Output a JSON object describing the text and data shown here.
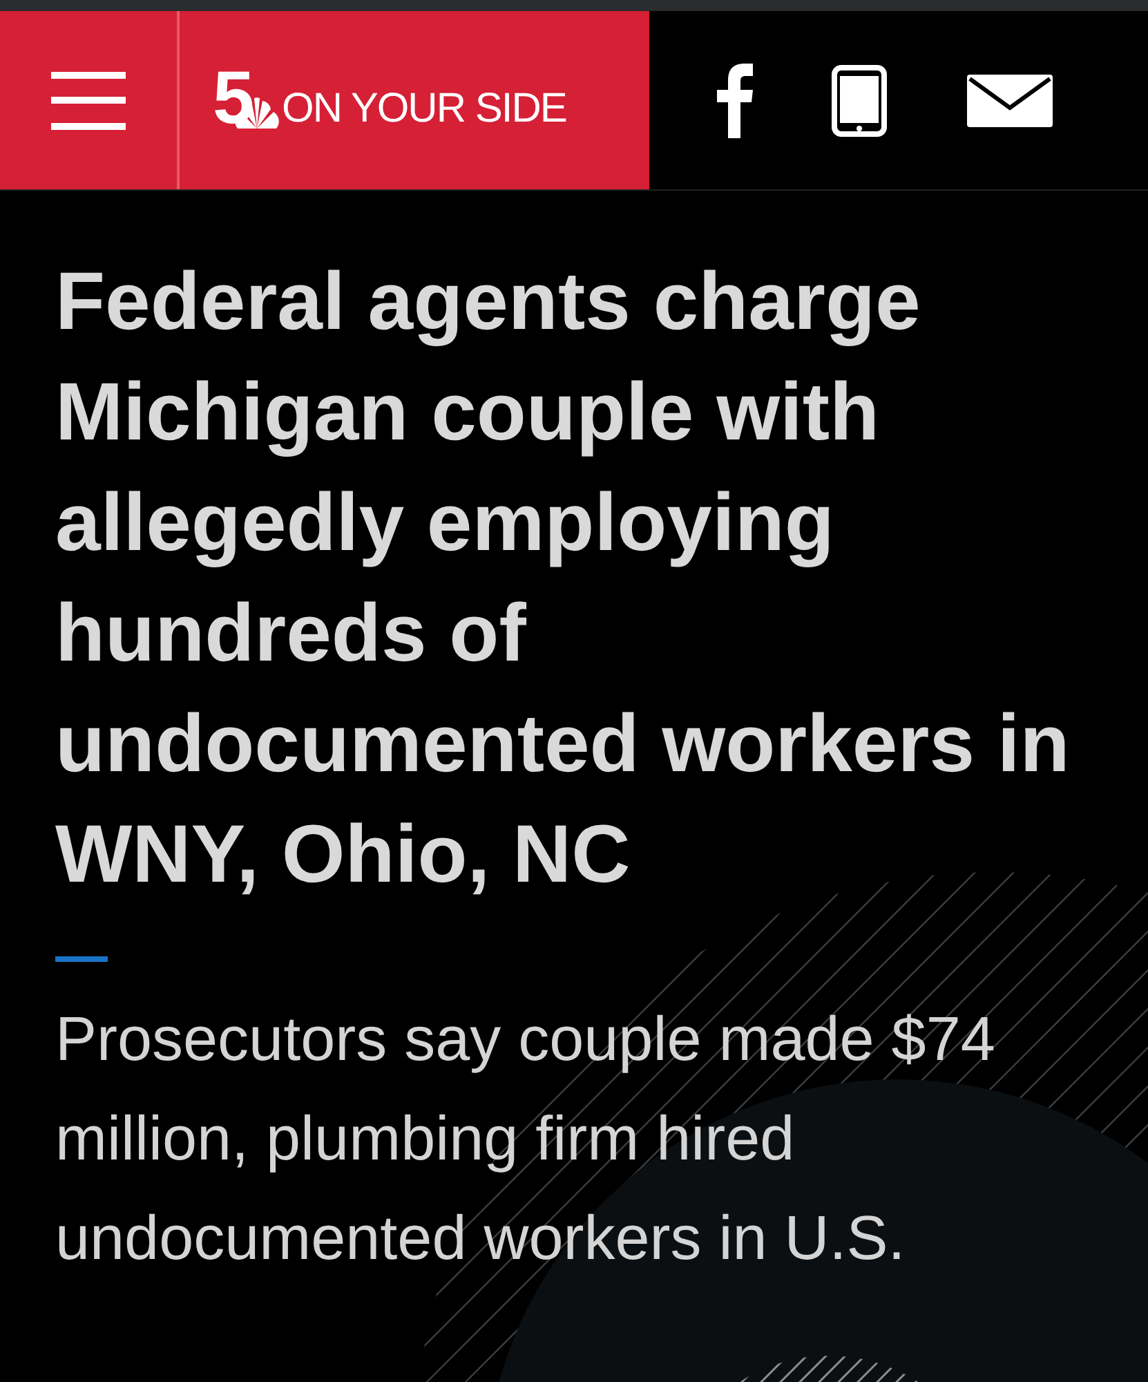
{
  "header": {
    "logo": {
      "number": "5",
      "text": "ON YOUR SIDE"
    }
  },
  "article": {
    "headline": "Federal agents charge Michigan couple with allegedly employing hundreds of undocumented workers in WNY, Ohio, NC",
    "subheadline": "Prosecutors say couple made $74 million, plumbing firm hired undocumented workers in U.S."
  }
}
